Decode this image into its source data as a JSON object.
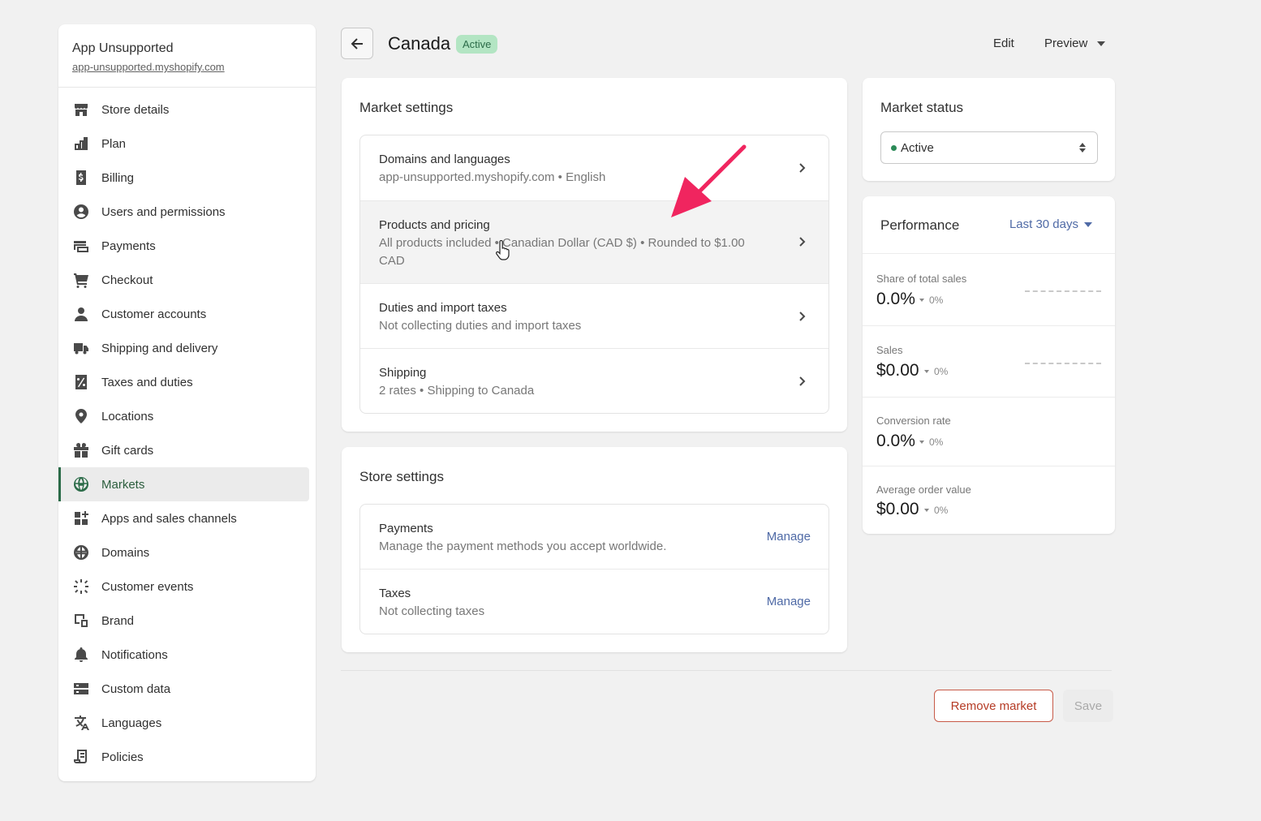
{
  "store": {
    "name": "App Unsupported",
    "url": "app-unsupported.myshopify.com"
  },
  "sidebar": {
    "items": [
      {
        "label": "Store details",
        "icon": "store-icon"
      },
      {
        "label": "Plan",
        "icon": "plan-icon"
      },
      {
        "label": "Billing",
        "icon": "billing-icon"
      },
      {
        "label": "Users and permissions",
        "icon": "user-icon"
      },
      {
        "label": "Payments",
        "icon": "payments-icon"
      },
      {
        "label": "Checkout",
        "icon": "cart-icon"
      },
      {
        "label": "Customer accounts",
        "icon": "person-icon"
      },
      {
        "label": "Shipping and delivery",
        "icon": "truck-icon"
      },
      {
        "label": "Taxes and duties",
        "icon": "tax-icon"
      },
      {
        "label": "Locations",
        "icon": "location-icon"
      },
      {
        "label": "Gift cards",
        "icon": "gift-icon"
      },
      {
        "label": "Markets",
        "icon": "globe-icon",
        "active": true
      },
      {
        "label": "Apps and sales channels",
        "icon": "apps-icon"
      },
      {
        "label": "Domains",
        "icon": "domain-globe-icon"
      },
      {
        "label": "Customer events",
        "icon": "sparkle-icon"
      },
      {
        "label": "Brand",
        "icon": "brand-icon"
      },
      {
        "label": "Notifications",
        "icon": "bell-icon"
      },
      {
        "label": "Custom data",
        "icon": "data-icon"
      },
      {
        "label": "Languages",
        "icon": "translate-icon"
      },
      {
        "label": "Policies",
        "icon": "policy-icon"
      }
    ]
  },
  "header": {
    "title": "Canada",
    "badge": "Active",
    "edit_label": "Edit",
    "preview_label": "Preview"
  },
  "market_settings": {
    "title": "Market settings",
    "rows": [
      {
        "title": "Domains and languages",
        "subtitle": "app-unsupported.myshopify.com • English"
      },
      {
        "title": "Products and pricing",
        "subtitle": "All products included • Canadian Dollar (CAD $) • Rounded to $1.00 CAD"
      },
      {
        "title": "Duties and import taxes",
        "subtitle": "Not collecting duties and import taxes"
      },
      {
        "title": "Shipping",
        "subtitle": "2 rates • Shipping to Canada"
      }
    ]
  },
  "store_settings": {
    "title": "Store settings",
    "rows": [
      {
        "title": "Payments",
        "subtitle": "Manage the payment methods you accept worldwide.",
        "action": "Manage"
      },
      {
        "title": "Taxes",
        "subtitle": "Not collecting taxes",
        "action": "Manage"
      }
    ]
  },
  "market_status": {
    "title": "Market status",
    "selected": "Active",
    "status_color": "#2b8a57"
  },
  "performance": {
    "title": "Performance",
    "range": "Last 30 days",
    "metrics": [
      {
        "label": "Share of total sales",
        "value": "0.0%",
        "delta": "0%"
      },
      {
        "label": "Sales",
        "value": "$0.00",
        "delta": "0%"
      },
      {
        "label": "Conversion rate",
        "value": "0.0%",
        "delta": "0%"
      },
      {
        "label": "Average order value",
        "value": "$0.00",
        "delta": "0%"
      }
    ]
  },
  "footer": {
    "remove_label": "Remove market",
    "save_label": "Save"
  },
  "colors": {
    "accent_green": "#2b6b48",
    "link_blue": "#4f6aa6",
    "danger": "#b53b25",
    "annotation_arrow": "#f0255f"
  }
}
